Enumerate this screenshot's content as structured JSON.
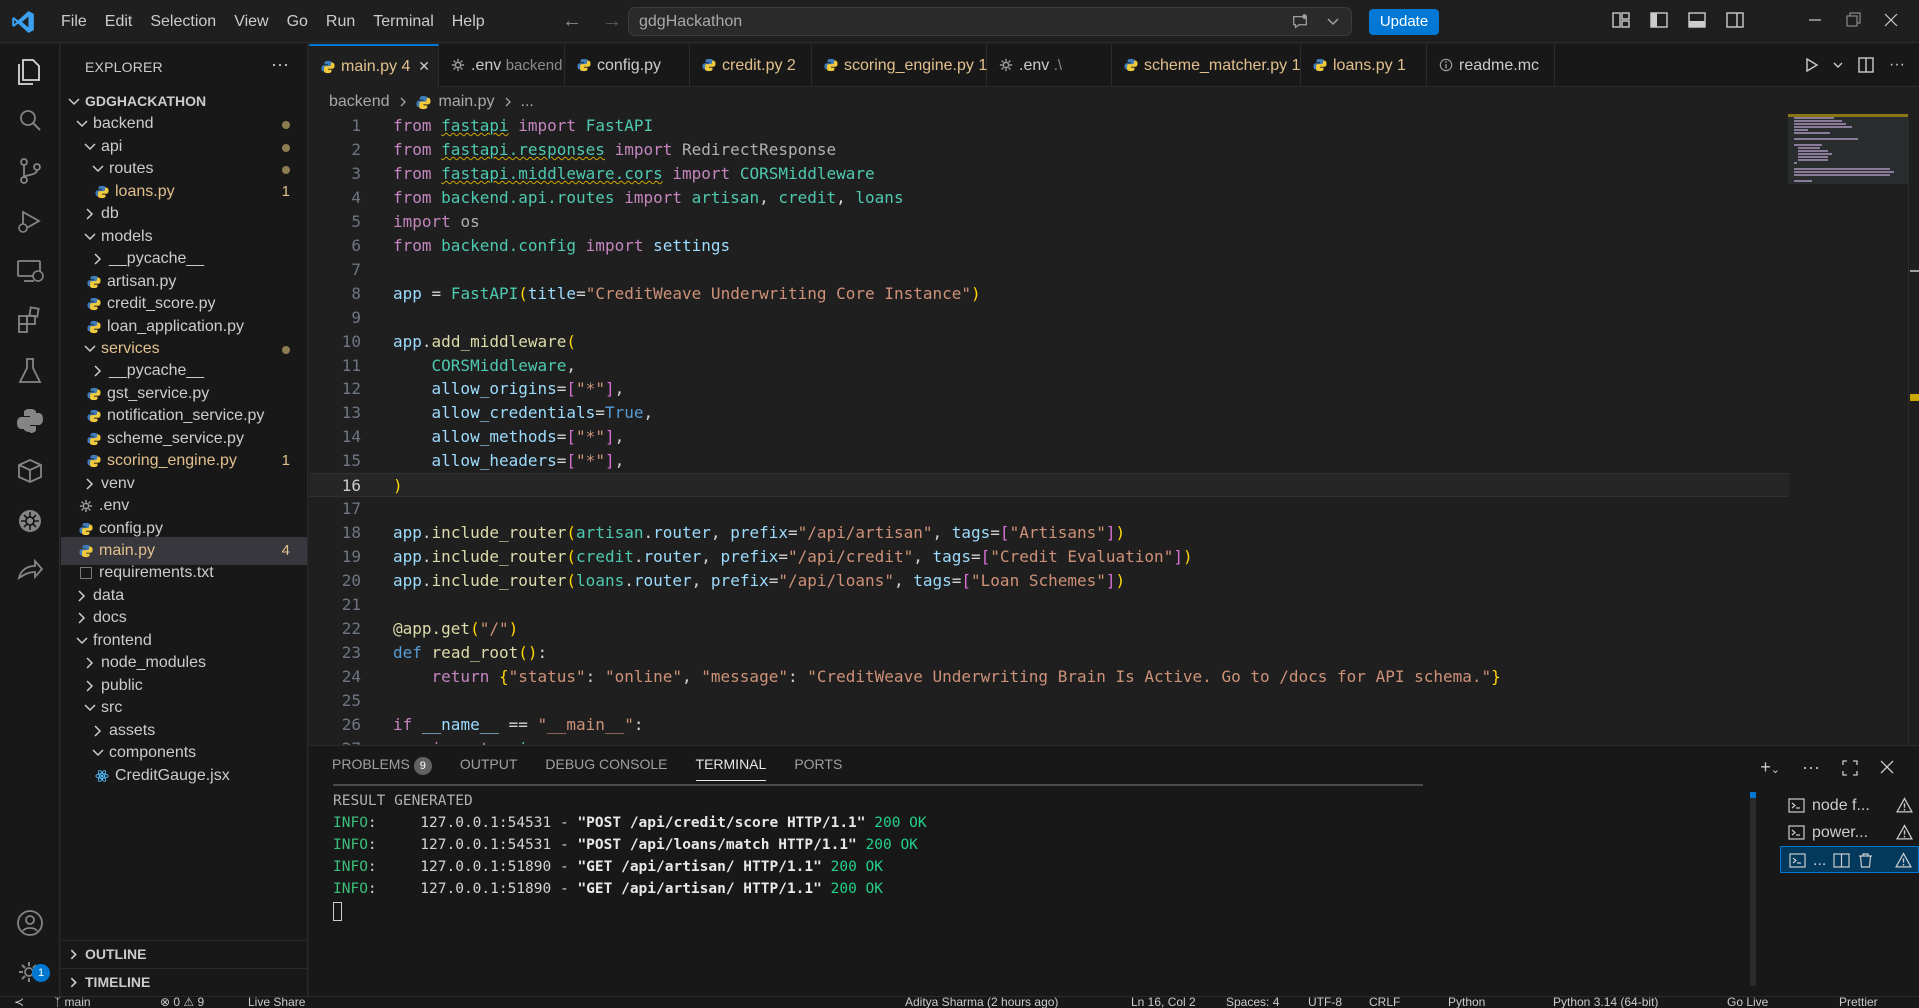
{
  "titlebar": {
    "menu": [
      "File",
      "Edit",
      "Selection",
      "View",
      "Go",
      "Run",
      "Terminal",
      "Help"
    ],
    "search_text": "gdgHackathon",
    "update_label": "Update"
  },
  "activity_bar": {
    "icons": [
      "explorer-icon",
      "search-icon",
      "source-control-icon",
      "run-debug-icon",
      "remote-explorer-icon",
      "extensions-icon",
      "testing-icon",
      "python-icon",
      "containers-icon",
      "kubernetes-icon",
      "live-share-icon",
      "accounts-icon",
      "manage-gear-icon"
    ],
    "manage_badge": "1"
  },
  "explorer": {
    "title": "EXPLORER",
    "more": "···",
    "tree": [
      {
        "label": "GDGHACKATHON",
        "type": "root",
        "indent": 0,
        "open": true
      },
      {
        "label": "backend",
        "type": "folder",
        "indent": 1,
        "open": true,
        "dot": true
      },
      {
        "label": "api",
        "type": "folder",
        "indent": 2,
        "open": true,
        "dot": true
      },
      {
        "label": "routes",
        "type": "folder",
        "indent": 3,
        "open": true,
        "dot": true
      },
      {
        "label": "loans.py",
        "type": "py",
        "indent": 4,
        "count": "1",
        "warn": true
      },
      {
        "label": "db",
        "type": "folder",
        "indent": 2,
        "open": false
      },
      {
        "label": "models",
        "type": "folder",
        "indent": 2,
        "open": true
      },
      {
        "label": "__pycache__",
        "type": "folder",
        "indent": 3,
        "open": false
      },
      {
        "label": "artisan.py",
        "type": "py",
        "indent": 3
      },
      {
        "label": "credit_score.py",
        "type": "py",
        "indent": 3
      },
      {
        "label": "loan_application.py",
        "type": "py",
        "indent": 3
      },
      {
        "label": "services",
        "type": "folder",
        "indent": 2,
        "open": true,
        "dot": true,
        "warn": true
      },
      {
        "label": "__pycache__",
        "type": "folder",
        "indent": 3,
        "open": false
      },
      {
        "label": "gst_service.py",
        "type": "py",
        "indent": 3
      },
      {
        "label": "notification_service.py",
        "type": "py",
        "indent": 3
      },
      {
        "label": "scheme_service.py",
        "type": "py",
        "indent": 3
      },
      {
        "label": "scoring_engine.py",
        "type": "py",
        "indent": 3,
        "count": "1",
        "warn": true
      },
      {
        "label": "venv",
        "type": "folder",
        "indent": 2,
        "open": false
      },
      {
        "label": ".env",
        "type": "gear",
        "indent": 2
      },
      {
        "label": "config.py",
        "type": "py",
        "indent": 2
      },
      {
        "label": "main.py",
        "type": "py",
        "indent": 2,
        "count": "4",
        "warn": true,
        "selected": true
      },
      {
        "label": "requirements.txt",
        "type": "txt",
        "indent": 2
      },
      {
        "label": "data",
        "type": "folder",
        "indent": 1,
        "open": false
      },
      {
        "label": "docs",
        "type": "folder",
        "indent": 1,
        "open": false
      },
      {
        "label": "frontend",
        "type": "folder",
        "indent": 1,
        "open": true
      },
      {
        "label": "node_modules",
        "type": "folder",
        "indent": 2,
        "open": false
      },
      {
        "label": "public",
        "type": "folder",
        "indent": 2,
        "open": false
      },
      {
        "label": "src",
        "type": "folder",
        "indent": 2,
        "open": true
      },
      {
        "label": "assets",
        "type": "folder",
        "indent": 3,
        "open": false
      },
      {
        "label": "components",
        "type": "folder",
        "indent": 3,
        "open": true
      },
      {
        "label": "CreditGauge.jsx",
        "type": "jsx",
        "indent": 4
      }
    ],
    "outline": "OUTLINE",
    "timeline": "TIMELINE"
  },
  "tabs": [
    {
      "label": "main.py",
      "suffix": "4",
      "icon": "python-file-icon",
      "active": true,
      "warn": true,
      "close": "✕"
    },
    {
      "label": ".env",
      "sub": "backend",
      "icon": "gear-file-icon"
    },
    {
      "label": "config.py",
      "icon": "python-file-icon"
    },
    {
      "label": "credit.py",
      "suffix": "2",
      "icon": "python-file-icon",
      "warn": true
    },
    {
      "label": "scoring_engine.py",
      "suffix": "1",
      "icon": "python-file-icon",
      "warn": true
    },
    {
      "label": ".env",
      "sub": ".\\",
      "icon": "gear-file-icon"
    },
    {
      "label": "scheme_matcher.py",
      "suffix": "1",
      "icon": "python-file-icon",
      "warn": true
    },
    {
      "label": "loans.py",
      "suffix": "1",
      "icon": "python-file-icon",
      "warn": true
    },
    {
      "label": "readme.mc",
      "icon": "info-file-icon"
    }
  ],
  "breadcrumb": {
    "folder": "backend",
    "file": "main.py",
    "tail": "..."
  },
  "editor": {
    "current_line": 16,
    "lines": [
      [
        [
          "kw",
          "from"
        ],
        [
          "def",
          " "
        ],
        [
          "cls sq",
          "fastapi"
        ],
        [
          "def",
          " "
        ],
        [
          "kw",
          "import"
        ],
        [
          "def",
          " "
        ],
        [
          "cls",
          "FastAPI"
        ]
      ],
      [
        [
          "kw",
          "from"
        ],
        [
          "def",
          " "
        ],
        [
          "cls sq",
          "fastapi.responses"
        ],
        [
          "def",
          " "
        ],
        [
          "kw",
          "import"
        ],
        [
          "def",
          " "
        ],
        [
          "dim",
          "RedirectResponse"
        ]
      ],
      [
        [
          "kw",
          "from"
        ],
        [
          "def",
          " "
        ],
        [
          "cls sq",
          "fastapi.middleware.cors"
        ],
        [
          "def",
          " "
        ],
        [
          "kw",
          "import"
        ],
        [
          "def",
          " "
        ],
        [
          "cls",
          "CORSMiddleware"
        ]
      ],
      [
        [
          "kw",
          "from"
        ],
        [
          "def",
          " "
        ],
        [
          "cls",
          "backend.api.routes"
        ],
        [
          "def",
          " "
        ],
        [
          "kw",
          "import"
        ],
        [
          "def",
          " "
        ],
        [
          "cls",
          "artisan"
        ],
        [
          "def",
          ", "
        ],
        [
          "cls",
          "credit"
        ],
        [
          "def",
          ", "
        ],
        [
          "cls",
          "loans"
        ]
      ],
      [
        [
          "kw",
          "import"
        ],
        [
          "def",
          " "
        ],
        [
          "dim",
          "os"
        ]
      ],
      [
        [
          "kw",
          "from"
        ],
        [
          "def",
          " "
        ],
        [
          "cls",
          "backend.config"
        ],
        [
          "def",
          " "
        ],
        [
          "kw",
          "import"
        ],
        [
          "def",
          " "
        ],
        [
          "var",
          "settings"
        ]
      ],
      [],
      [
        [
          "var",
          "app"
        ],
        [
          "def",
          " = "
        ],
        [
          "cls",
          "FastAPI"
        ],
        [
          "br1",
          "("
        ],
        [
          "prm",
          "title"
        ],
        [
          "def",
          "="
        ],
        [
          "str",
          "\"CreditWeave Underwriting Core Instance\""
        ],
        [
          "br1",
          ")"
        ]
      ],
      [],
      [
        [
          "var",
          "app"
        ],
        [
          "def",
          "."
        ],
        [
          "fn",
          "add_middleware"
        ],
        [
          "br1",
          "("
        ]
      ],
      [
        [
          "def",
          "    "
        ],
        [
          "cls",
          "CORSMiddleware"
        ],
        [
          "def",
          ","
        ]
      ],
      [
        [
          "def",
          "    "
        ],
        [
          "prm",
          "allow_origins"
        ],
        [
          "def",
          "="
        ],
        [
          "br2",
          "["
        ],
        [
          "str",
          "\"*\""
        ],
        [
          "br2",
          "]"
        ],
        [
          "def",
          ","
        ]
      ],
      [
        [
          "def",
          "    "
        ],
        [
          "prm",
          "allow_credentials"
        ],
        [
          "def",
          "="
        ],
        [
          "bi",
          "True"
        ],
        [
          "def",
          ","
        ]
      ],
      [
        [
          "def",
          "    "
        ],
        [
          "prm",
          "allow_methods"
        ],
        [
          "def",
          "="
        ],
        [
          "br2",
          "["
        ],
        [
          "str",
          "\"*\""
        ],
        [
          "br2",
          "]"
        ],
        [
          "def",
          ","
        ]
      ],
      [
        [
          "def",
          "    "
        ],
        [
          "prm",
          "allow_headers"
        ],
        [
          "def",
          "="
        ],
        [
          "br2",
          "["
        ],
        [
          "str",
          "\"*\""
        ],
        [
          "br2",
          "]"
        ],
        [
          "def",
          ","
        ]
      ],
      [
        [
          "br1",
          ")"
        ]
      ],
      [],
      [
        [
          "var",
          "app"
        ],
        [
          "def",
          "."
        ],
        [
          "fn",
          "include_router"
        ],
        [
          "br1",
          "("
        ],
        [
          "cls",
          "artisan"
        ],
        [
          "def",
          "."
        ],
        [
          "var",
          "router"
        ],
        [
          "def",
          ", "
        ],
        [
          "prm",
          "prefix"
        ],
        [
          "def",
          "="
        ],
        [
          "str",
          "\"/api/artisan\""
        ],
        [
          "def",
          ", "
        ],
        [
          "prm",
          "tags"
        ],
        [
          "def",
          "="
        ],
        [
          "br2",
          "["
        ],
        [
          "str",
          "\"Artisans\""
        ],
        [
          "br2",
          "]"
        ],
        [
          "br1",
          ")"
        ]
      ],
      [
        [
          "var",
          "app"
        ],
        [
          "def",
          "."
        ],
        [
          "fn",
          "include_router"
        ],
        [
          "br1",
          "("
        ],
        [
          "cls",
          "credit"
        ],
        [
          "def",
          "."
        ],
        [
          "var",
          "router"
        ],
        [
          "def",
          ", "
        ],
        [
          "prm",
          "prefix"
        ],
        [
          "def",
          "="
        ],
        [
          "str",
          "\"/api/credit\""
        ],
        [
          "def",
          ", "
        ],
        [
          "prm",
          "tags"
        ],
        [
          "def",
          "="
        ],
        [
          "br2",
          "["
        ],
        [
          "str",
          "\"Credit Evaluation\""
        ],
        [
          "br2",
          "]"
        ],
        [
          "br1",
          ")"
        ]
      ],
      [
        [
          "var",
          "app"
        ],
        [
          "def",
          "."
        ],
        [
          "fn",
          "include_router"
        ],
        [
          "br1",
          "("
        ],
        [
          "cls",
          "loans"
        ],
        [
          "def",
          "."
        ],
        [
          "var",
          "router"
        ],
        [
          "def",
          ", "
        ],
        [
          "prm",
          "prefix"
        ],
        [
          "def",
          "="
        ],
        [
          "str",
          "\"/api/loans\""
        ],
        [
          "def",
          ", "
        ],
        [
          "prm",
          "tags"
        ],
        [
          "def",
          "="
        ],
        [
          "br2",
          "["
        ],
        [
          "str",
          "\"Loan Schemes\""
        ],
        [
          "br2",
          "]"
        ],
        [
          "br1",
          ")"
        ]
      ],
      [],
      [
        [
          "fn",
          "@app.get"
        ],
        [
          "br1",
          "("
        ],
        [
          "str",
          "\"/\""
        ],
        [
          "br1",
          ")"
        ]
      ],
      [
        [
          "bi",
          "def"
        ],
        [
          "def",
          " "
        ],
        [
          "fn",
          "read_root"
        ],
        [
          "br1",
          "()"
        ],
        [
          "def",
          ":"
        ]
      ],
      [
        [
          "def",
          "    "
        ],
        [
          "kw",
          "return"
        ],
        [
          "def",
          " "
        ],
        [
          "br1",
          "{"
        ],
        [
          "str",
          "\"status\""
        ],
        [
          "def",
          ": "
        ],
        [
          "str",
          "\"online\""
        ],
        [
          "def",
          ", "
        ],
        [
          "str",
          "\"message\""
        ],
        [
          "def",
          ": "
        ],
        [
          "str",
          "\"CreditWeave Underwriting Brain Is Active. Go to /docs for API schema.\""
        ],
        [
          "br1",
          "}"
        ]
      ],
      [],
      [
        [
          "kw",
          "if"
        ],
        [
          "def",
          " "
        ],
        [
          "var",
          "__name__"
        ],
        [
          "def",
          " == "
        ],
        [
          "str",
          "\"__main__\""
        ],
        [
          "def",
          ":"
        ]
      ],
      [
        [
          "def",
          "    "
        ],
        [
          "kw",
          "import"
        ],
        [
          "def",
          " "
        ],
        [
          "cls sq",
          "uvicorn"
        ]
      ]
    ]
  },
  "panel": {
    "tabs": [
      "PROBLEMS",
      "OUTPUT",
      "DEBUG CONSOLE",
      "TERMINAL",
      "PORTS"
    ],
    "problems_count": "9",
    "active_tab": "TERMINAL",
    "terminal_lines": [
      {
        "parts": [
          [
            "dim",
            "RESULT GENERATED"
          ]
        ]
      },
      {
        "parts": [
          [
            "t-info",
            "INFO"
          ],
          [
            "def",
            ":     127.0.0.1:54531 - "
          ],
          [
            "t-bold",
            "\"POST /api/credit/score HTTP/1.1\""
          ],
          [
            "def",
            " "
          ],
          [
            "t-ok",
            "200 OK"
          ]
        ]
      },
      {
        "parts": [
          [
            "t-info",
            "INFO"
          ],
          [
            "def",
            ":     127.0.0.1:54531 - "
          ],
          [
            "t-bold",
            "\"POST /api/loans/match HTTP/1.1\""
          ],
          [
            "def",
            " "
          ],
          [
            "t-ok",
            "200 OK"
          ]
        ]
      },
      {
        "parts": [
          [
            "t-info",
            "INFO"
          ],
          [
            "def",
            ":     127.0.0.1:51890 - "
          ],
          [
            "t-bold",
            "\"GET /api/artisan/ HTTP/1.1\""
          ],
          [
            "def",
            " "
          ],
          [
            "t-ok",
            "200 OK"
          ]
        ]
      },
      {
        "parts": [
          [
            "t-info",
            "INFO"
          ],
          [
            "def",
            ":     127.0.0.1:51890 - "
          ],
          [
            "t-bold",
            "\"GET /api/artisan/ HTTP/1.1\""
          ],
          [
            "def",
            " "
          ],
          [
            "t-ok",
            "200 OK"
          ]
        ]
      }
    ],
    "terminals": [
      {
        "label": "node f...",
        "selected": false
      },
      {
        "label": "power...",
        "selected": false
      },
      {
        "label": "...",
        "selected": true
      }
    ]
  },
  "statusbar": {
    "branch": "main",
    "errors": "0",
    "warnings": "9",
    "live_share": "Live Share",
    "blame": "Aditya Sharma (2 hours ago)",
    "position": "Ln 16, Col 2",
    "spaces": "Spaces: 4",
    "encoding": "UTF-8",
    "eol": "CRLF",
    "language": "Python",
    "interpreter": "Python 3.14 (64-bit)",
    "go_live": "Go Live",
    "prettier": "Prettier"
  },
  "colors": {
    "accent": "#0078d4",
    "warning": "#cca700",
    "modified": "#e2c08d",
    "ok": "#23d18b"
  }
}
